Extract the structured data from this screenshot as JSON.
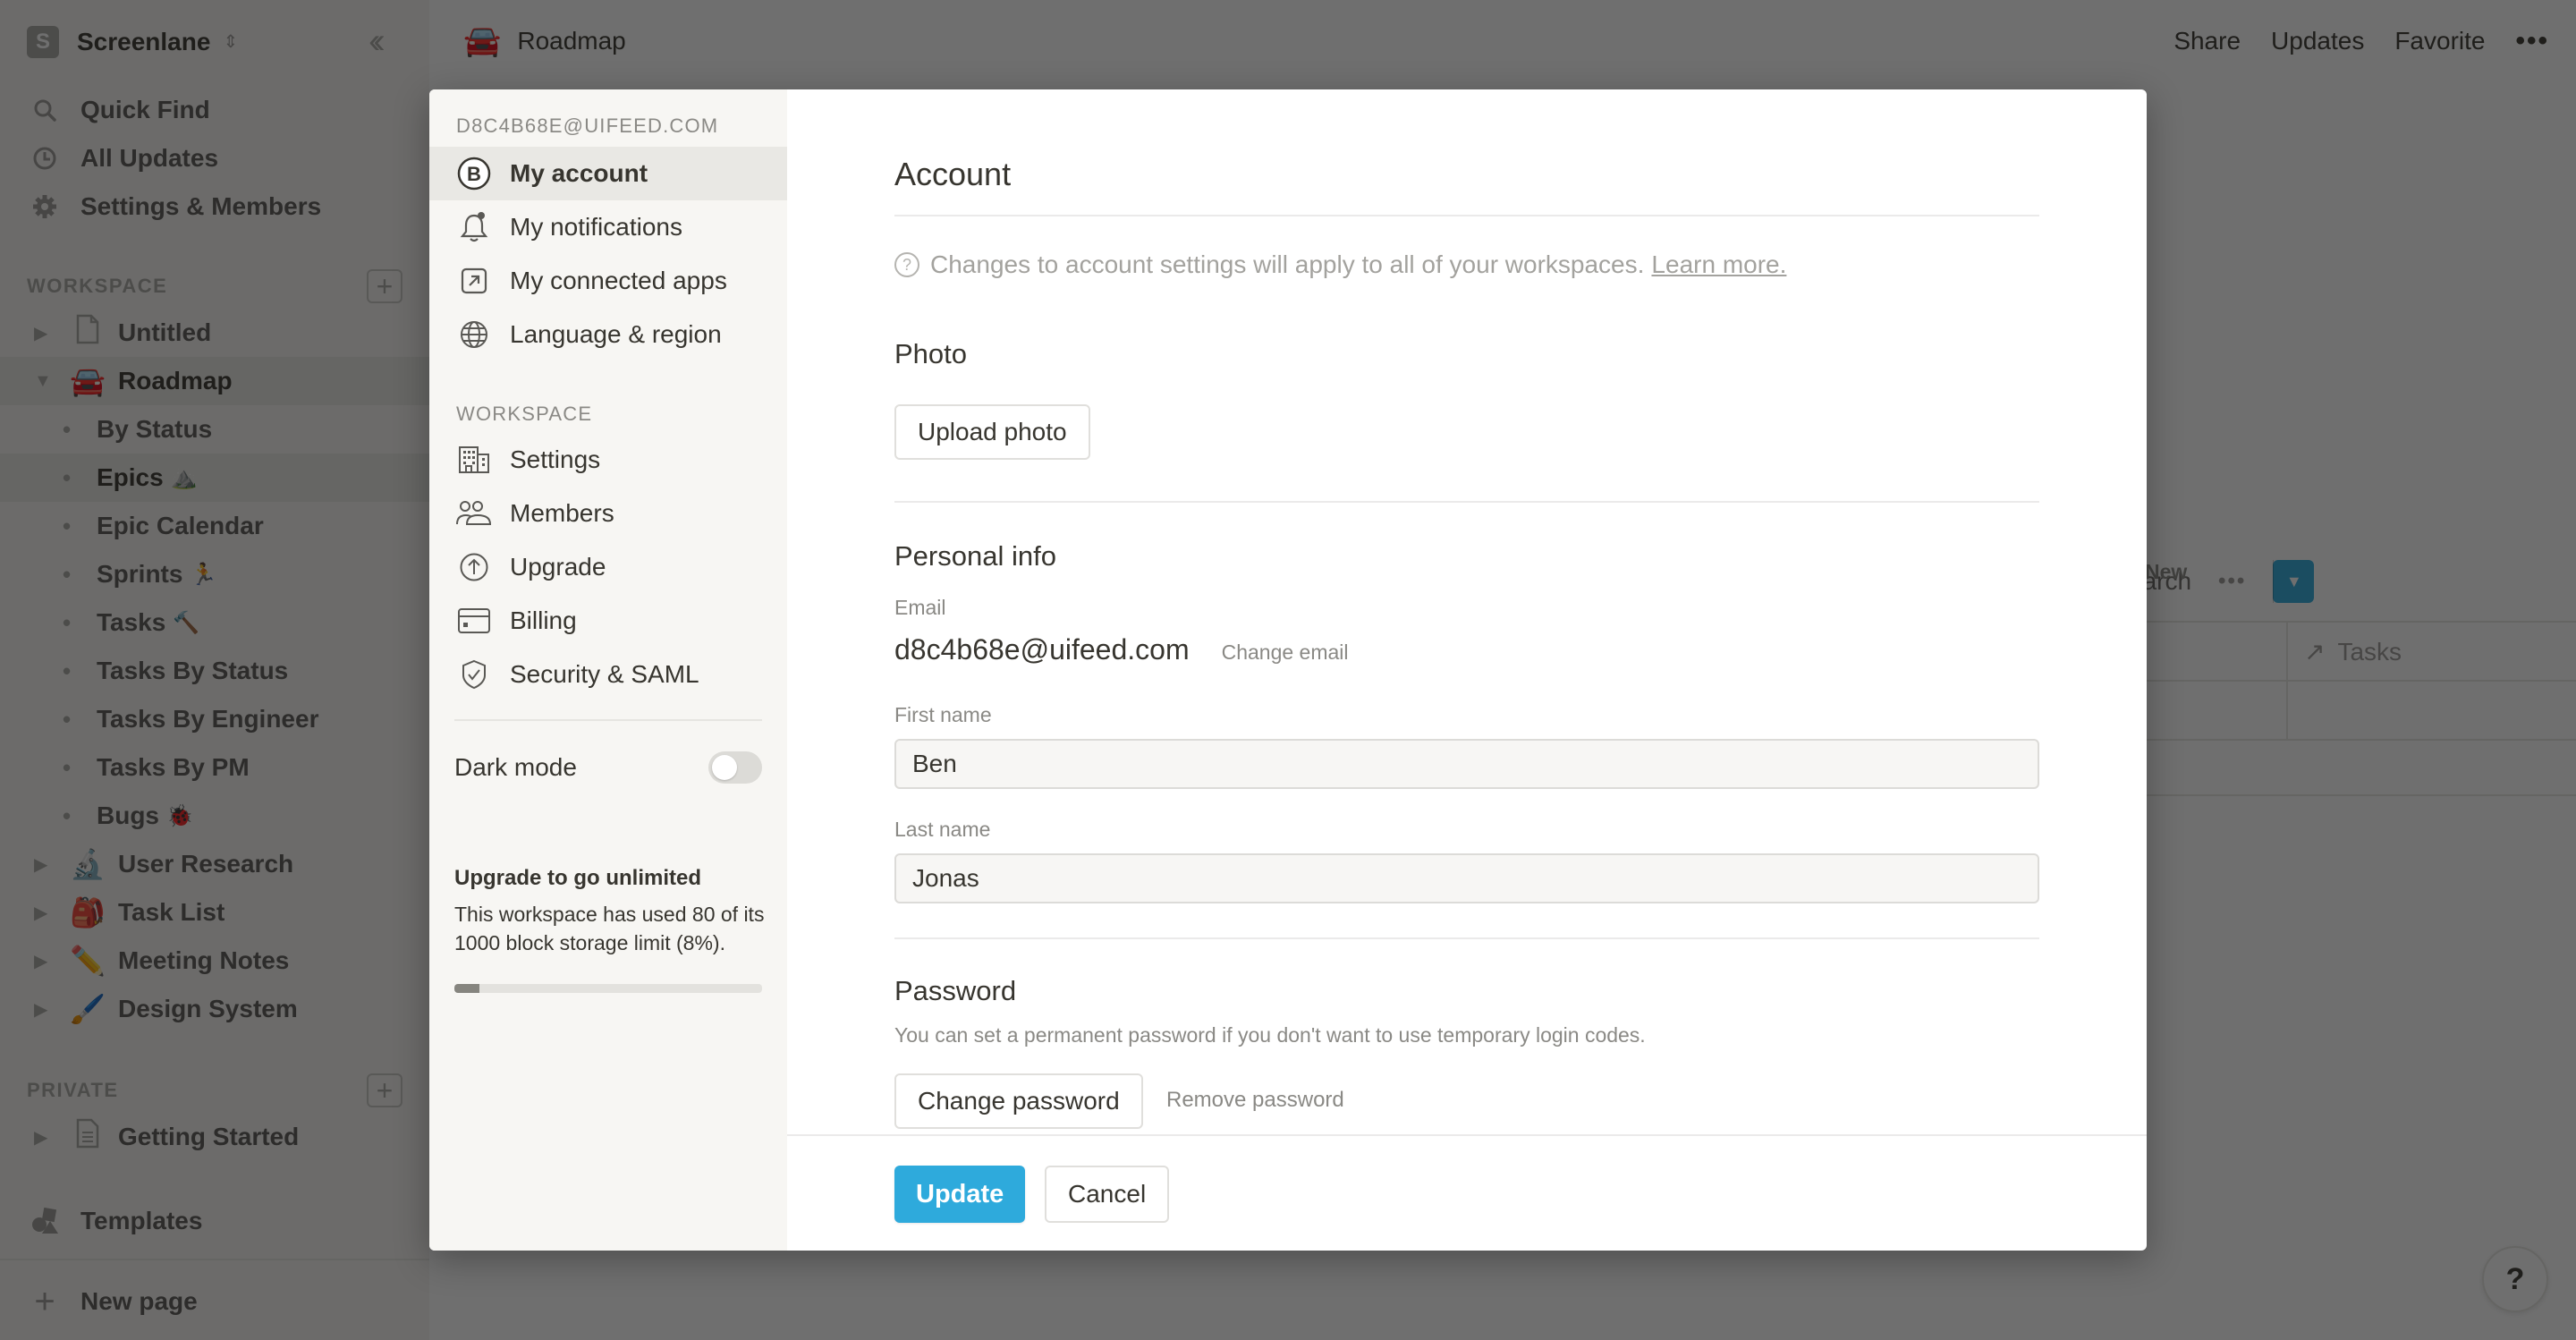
{
  "sidebar": {
    "workspace_initial": "S",
    "workspace_name": "Screenlane",
    "collapse_icon": "double-chevron-left-icon",
    "nav": [
      {
        "label": "Quick Find",
        "icon": "search-icon"
      },
      {
        "label": "All Updates",
        "icon": "clock-icon"
      },
      {
        "label": "Settings & Members",
        "icon": "gear-icon"
      }
    ],
    "workspace_section": "WORKSPACE",
    "private_section": "PRIVATE",
    "pages": [
      {
        "label": "Untitled",
        "emoji": "📄",
        "expanded": false
      },
      {
        "label": "Roadmap",
        "emoji": "🚘",
        "expanded": true
      }
    ],
    "roadmap_children": [
      {
        "label": "By Status",
        "suffix": ""
      },
      {
        "label": "Epics",
        "suffix": "⛰️"
      },
      {
        "label": "Epic Calendar",
        "suffix": ""
      },
      {
        "label": "Sprints",
        "suffix": "🏃"
      },
      {
        "label": "Tasks",
        "suffix": "🔨"
      },
      {
        "label": "Tasks By Status",
        "suffix": ""
      },
      {
        "label": "Tasks By Engineer",
        "suffix": ""
      },
      {
        "label": "Tasks By PM",
        "suffix": ""
      },
      {
        "label": "Bugs",
        "suffix": "🐞"
      }
    ],
    "more_pages": [
      {
        "label": "User Research",
        "emoji": "🔬"
      },
      {
        "label": "Task List",
        "emoji": "🎒"
      },
      {
        "label": "Meeting Notes",
        "emoji": "✏️"
      },
      {
        "label": "Design System",
        "emoji": "🖌️"
      }
    ],
    "private_pages": [
      {
        "label": "Getting Started",
        "emoji": "📄"
      }
    ],
    "templates_label": "Templates",
    "new_page_label": "New page"
  },
  "topbar": {
    "page_emoji": "🚘",
    "page_title": "Roadmap",
    "share": "Share",
    "updates": "Updates",
    "favorite": "Favorite",
    "more": "•••"
  },
  "database": {
    "search_partial": "earch",
    "more": "•••",
    "new_label": "New",
    "column_tasks": "Tasks"
  },
  "help_label": "?",
  "modal": {
    "nav": {
      "email_header": "D8C4B68E@UIFEED.COM",
      "account_items": [
        {
          "label": "My account",
          "icon": "avatar-b-icon",
          "active": true
        },
        {
          "label": "My notifications",
          "icon": "bell-icon"
        },
        {
          "label": "My connected apps",
          "icon": "external-link-icon"
        },
        {
          "label": "Language & region",
          "icon": "globe-icon"
        }
      ],
      "workspace_header": "WORKSPACE",
      "workspace_items": [
        {
          "label": "Settings",
          "icon": "building-icon"
        },
        {
          "label": "Members",
          "icon": "people-icon"
        },
        {
          "label": "Upgrade",
          "icon": "arrow-up-circle-icon"
        },
        {
          "label": "Billing",
          "icon": "credit-card-icon"
        },
        {
          "label": "Security & SAML",
          "icon": "shield-check-icon"
        }
      ],
      "dark_mode_label": "Dark mode",
      "dark_mode_on": false,
      "upgrade_title": "Upgrade to go unlimited",
      "upgrade_desc": "This workspace has used 80 of its 1000 block storage limit (8%).",
      "storage_used_percent": 8
    },
    "account": {
      "title": "Account",
      "notice": "Changes to account settings will apply to all of your workspaces.",
      "learn_more": "Learn more.",
      "photo_heading": "Photo",
      "upload_photo": "Upload photo",
      "personal_heading": "Personal info",
      "email_label": "Email",
      "email_value": "d8c4b68e@uifeed.com",
      "change_email": "Change email",
      "first_name_label": "First name",
      "first_name_value": "Ben",
      "last_name_label": "Last name",
      "last_name_value": "Jonas",
      "password_heading": "Password",
      "password_desc": "You can set a permanent password if you don't want to use temporary login codes.",
      "change_password": "Change password",
      "remove_password": "Remove password"
    },
    "footer": {
      "update": "Update",
      "cancel": "Cancel"
    },
    "colors": {
      "primary": "#2eaadc",
      "nav_bg": "#f7f6f3",
      "active_bg": "#e9e8e4"
    }
  }
}
